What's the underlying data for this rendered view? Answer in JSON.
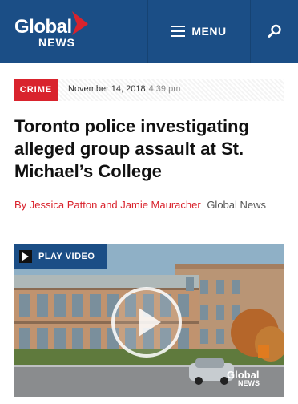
{
  "header": {
    "logo_global": "Global",
    "logo_news": "NEWS",
    "menu_label": "MENU",
    "bg_color": "#1b4e86"
  },
  "article": {
    "category": "CRIME",
    "date": "November 14, 2018",
    "time": "4:39 pm",
    "title": "Toronto police investigating alleged group assault at St. Michael’s College",
    "byline_prefix": "By",
    "authors": "Jessica Patton and Jamie Mauracher",
    "source": "Global News"
  },
  "video": {
    "play_label": "PLAY VIDEO",
    "watermark_global": "Global",
    "watermark_news": "NEWS"
  },
  "icons": {
    "menu": "hamburger-icon",
    "search": "search-icon",
    "play": "play-icon"
  },
  "colors": {
    "accent_red": "#d9232d",
    "brand_blue": "#1b4e86"
  }
}
